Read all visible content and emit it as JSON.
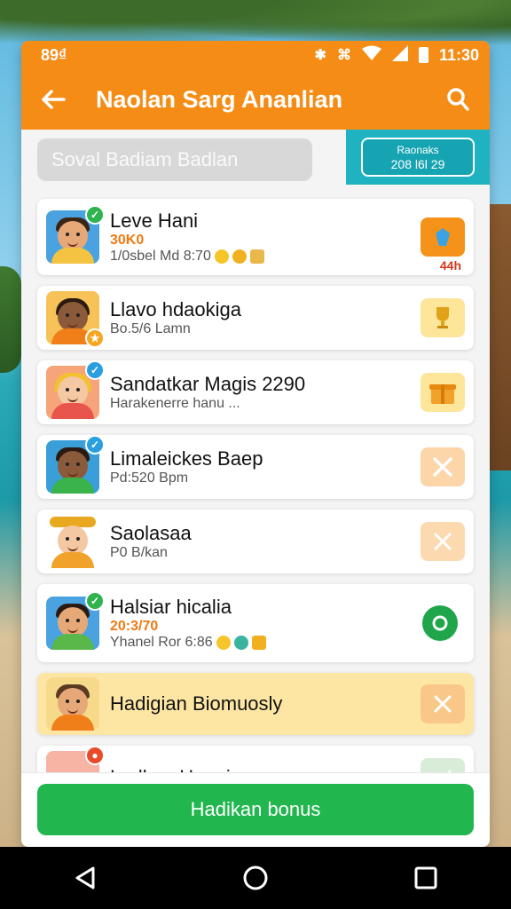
{
  "status_bar": {
    "left": "89₫",
    "time": "11:30"
  },
  "header": {
    "title": "Naolan Sarg Ananlian"
  },
  "search": {
    "placeholder": "Soval Badiam Badlan"
  },
  "bonus_badge": {
    "line1": "Raonaks",
    "line2": "208 l6l 29"
  },
  "rows": [
    {
      "name": "Leve Hani",
      "amount": "30K0",
      "sub": "1/0sbel Md 8:70",
      "action_label": "44h",
      "action_icon": "gem-icon"
    },
    {
      "name": "Llavo hdaokiga",
      "sub": "Bo.5/6 Lamn",
      "action_icon": "trophy-icon"
    },
    {
      "name": "Sandatkar Magis 2290",
      "sub": "Harakenerre hanu  ...",
      "action_icon": "gift-icon"
    },
    {
      "name": "Limaleickes Baep",
      "sub": "Pd:520 Bpm",
      "action_icon": "crossed-tools-icon"
    },
    {
      "name": "Saolasaa",
      "sub": "P0 B/kan",
      "action_icon": "close-icon"
    },
    {
      "name": "Halsiar hicalia",
      "amount": "20:3/70",
      "sub": "Yhanel Ror 6:86",
      "action_icon": "refresh-icon"
    },
    {
      "name": "Hadigian Biomuosly",
      "action_icon": "close-icon"
    },
    {
      "name": "Ladkan Haaui",
      "action_icon": "check-icon"
    }
  ],
  "cta": {
    "label": "Hadikan bonus"
  },
  "colors": {
    "primary_orange": "#f58c16",
    "teal": "#1fb3c2",
    "green": "#22b64f",
    "highlight": "#fde6a4"
  }
}
